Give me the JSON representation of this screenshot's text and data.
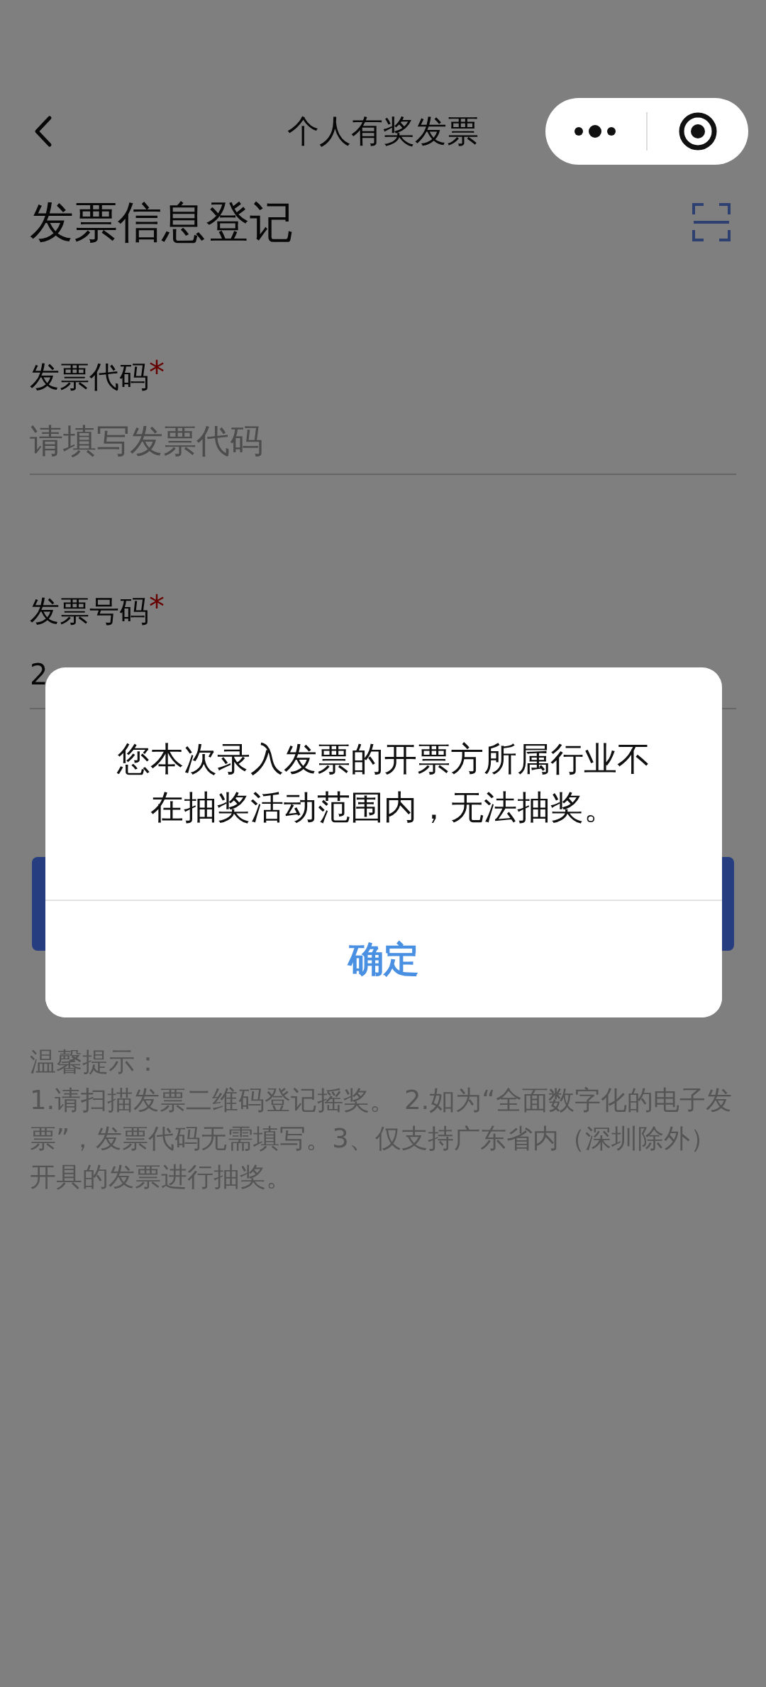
{
  "nav": {
    "title": "个人有奖发票"
  },
  "page_title": "发票信息登记",
  "fields": [
    {
      "label": "发票代码",
      "required_mark": "*",
      "placeholder": "请填写发票代码"
    },
    {
      "label": "发票号码",
      "required_mark": "*",
      "value": "2"
    }
  ],
  "tips": {
    "title": "温馨提示：",
    "text": "1.请扫描发票二维码登记摇奖。 2.如为“全面数字化的电子发票”，发票代码无需填写。3、仅支持广东省内（深圳除外）开具的发票进行抽奖。"
  },
  "dialog": {
    "message": "您本次录入发票的开票方所属行业不在抽奖活动范围内，无法抽奖。",
    "button": "确定"
  }
}
